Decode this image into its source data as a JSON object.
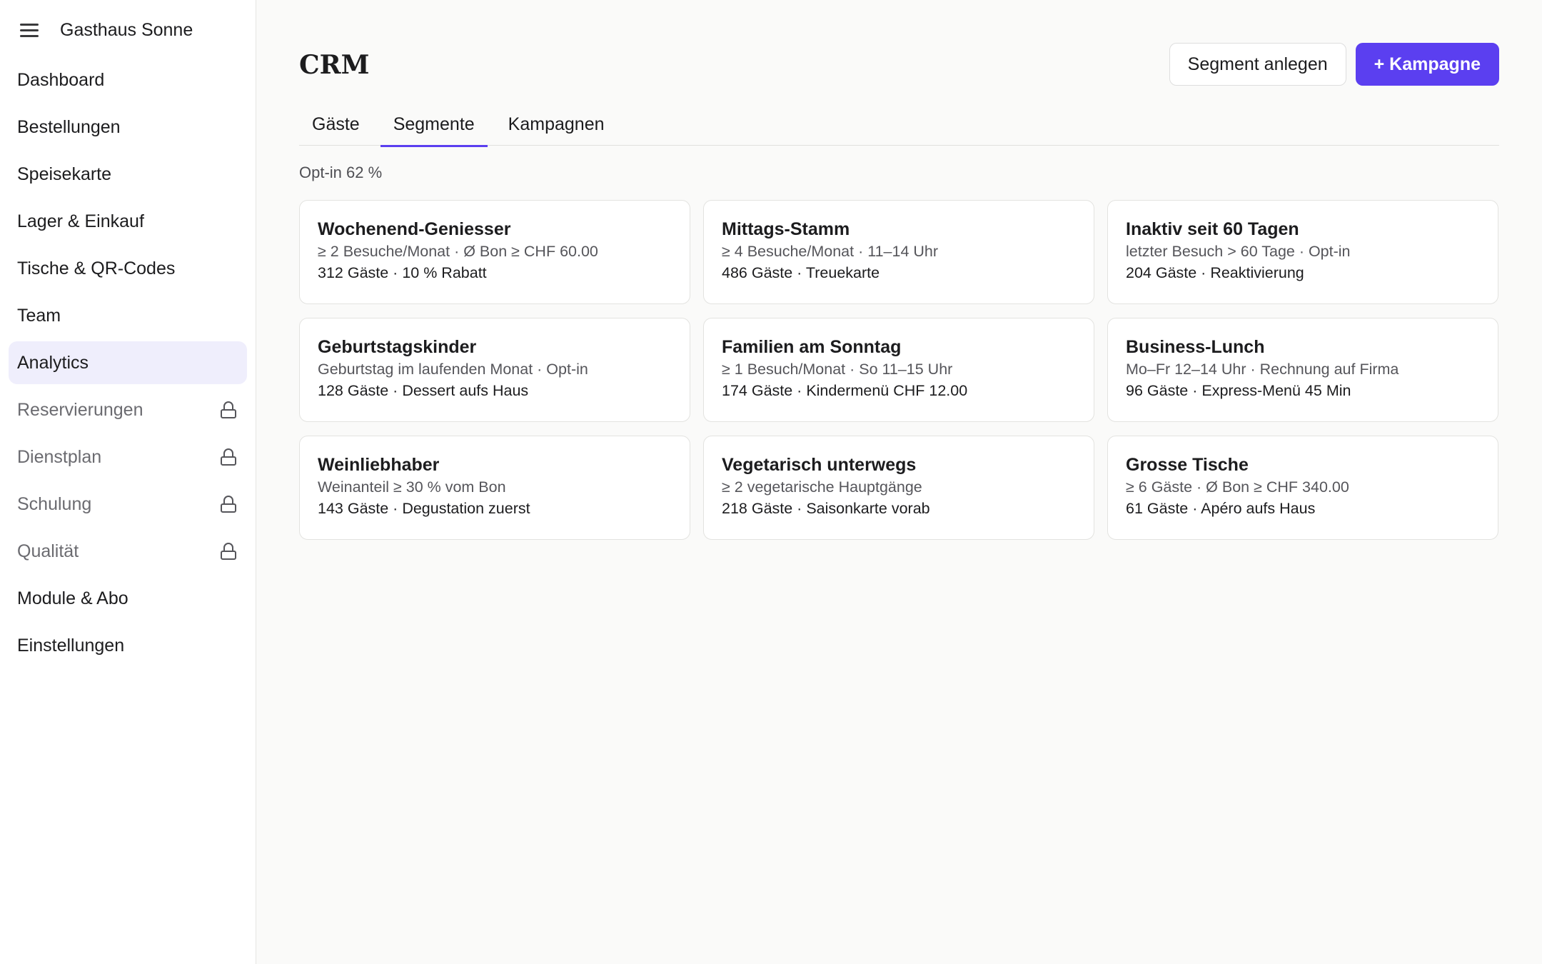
{
  "brand": {
    "name": "Gasthaus Sonne"
  },
  "sidebar": {
    "items": [
      {
        "label": "Dashboard"
      },
      {
        "label": "Bestellungen"
      },
      {
        "label": "Speisekarte"
      },
      {
        "label": "Lager & Einkauf"
      },
      {
        "label": "Tische & QR-Codes"
      },
      {
        "label": "Team"
      },
      {
        "label": "Analytics"
      },
      {
        "label": "Reservierungen"
      },
      {
        "label": "Dienstplan"
      },
      {
        "label": "Schulung"
      },
      {
        "label": "Qualität"
      },
      {
        "label": "Module & Abo"
      },
      {
        "label": "Einstellungen"
      }
    ]
  },
  "header": {
    "title": "CRM",
    "segment_button": "Segment anlegen",
    "campaign_button": "+ Kampagne"
  },
  "tabs": [
    {
      "label": "Gäste"
    },
    {
      "label": "Segmente"
    },
    {
      "label": "Kampagnen"
    }
  ],
  "optin": "Opt-in 62 %",
  "segments": [
    {
      "title": "Wochenend-Geniesser",
      "rule": "≥ 2 Besuche/Monat · Ø Bon ≥ CHF 60.00",
      "stat": "312 Gäste · 10 % Rabatt"
    },
    {
      "title": "Mittags-Stamm",
      "rule": "≥ 4 Besuche/Monat · 11–14 Uhr",
      "stat": "486 Gäste · Treuekarte"
    },
    {
      "title": "Inaktiv seit 60 Tagen",
      "rule": "letzter Besuch > 60 Tage · Opt-in",
      "stat": "204 Gäste · Reaktivierung"
    },
    {
      "title": "Geburtstagskinder",
      "rule": "Geburtstag im laufenden Monat · Opt-in",
      "stat": "128 Gäste · Dessert aufs Haus"
    },
    {
      "title": "Familien am Sonntag",
      "rule": "≥ 1 Besuch/Monat · So 11–15 Uhr",
      "stat": "174 Gäste · Kindermenü CHF 12.00"
    },
    {
      "title": "Business-Lunch",
      "rule": "Mo–Fr 12–14 Uhr · Rechnung auf Firma",
      "stat": "96 Gäste · Express-Menü 45 Min"
    },
    {
      "title": "Weinliebhaber",
      "rule": "Weinanteil ≥ 30 % vom Bon",
      "stat": "143 Gäste · Degustation zuerst"
    },
    {
      "title": "Vegetarisch unterwegs",
      "rule": "≥ 2 vegetarische Hauptgänge",
      "stat": "218 Gäste · Saisonkarte vorab"
    },
    {
      "title": "Grosse Tische",
      "rule": "≥ 6 Gäste · Ø Bon ≥ CHF 340.00",
      "stat": "61 Gäste · Apéro aufs Haus"
    }
  ]
}
